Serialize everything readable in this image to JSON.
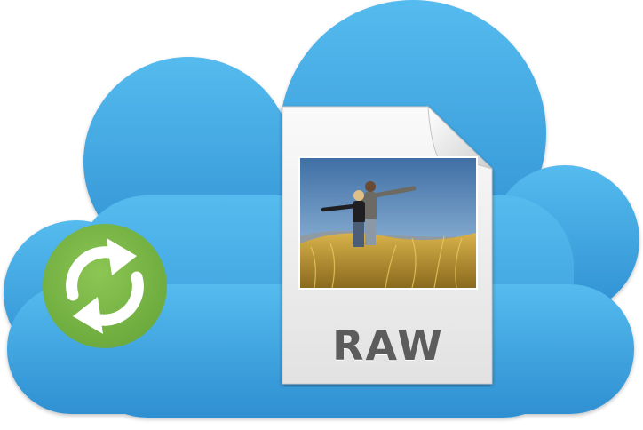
{
  "illustration": {
    "file_type_label": "RAW"
  },
  "icons": {
    "cloud": "cloud-icon",
    "sync": "sync-icon",
    "file": "raw-file-icon",
    "photo": "photo-thumbnail"
  },
  "colors": {
    "cloud_top": "#4fb6ea",
    "cloud_bottom": "#2f8fd0",
    "sync_green": "#7ab648",
    "file_paper": "#f4f4f4",
    "label_text": "#5c5c5c"
  }
}
